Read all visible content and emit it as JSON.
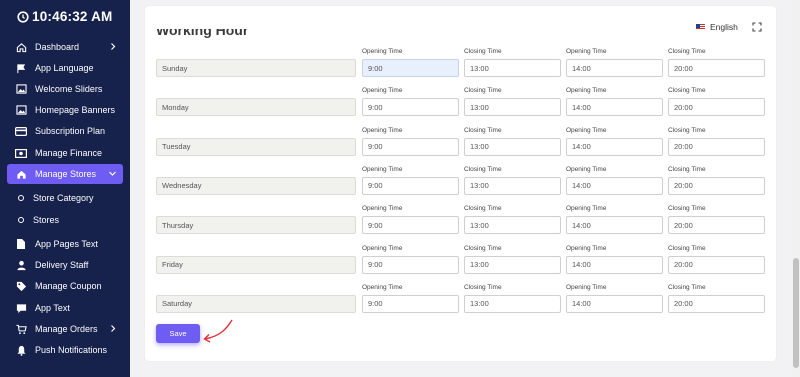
{
  "clock": "10:46:32 AM",
  "sidebar": {
    "items": [
      {
        "label": "Dashboard",
        "icon": "home-icon",
        "chevron": "right"
      },
      {
        "label": "App Language",
        "icon": "flag-icon"
      },
      {
        "label": "Welcome Sliders",
        "icon": "image-icon"
      },
      {
        "label": "Homepage Banners",
        "icon": "image-icon"
      },
      {
        "label": "Subscription Plan",
        "icon": "card-icon"
      },
      {
        "label": "Manage Finance",
        "icon": "money-icon"
      },
      {
        "label": "Manage Stores",
        "icon": "store-icon",
        "chevron": "down",
        "active": true
      },
      {
        "label": "Store Category",
        "icon": "circle-icon",
        "sub": true
      },
      {
        "label": "Stores",
        "icon": "circle-icon",
        "sub": true
      },
      {
        "label": "App Pages Text",
        "icon": "file-icon"
      },
      {
        "label": "Delivery Staff",
        "icon": "user-icon"
      },
      {
        "label": "Manage Coupon",
        "icon": "tag-icon"
      },
      {
        "label": "App Text",
        "icon": "chat-icon"
      },
      {
        "label": "Manage Orders",
        "icon": "cart-icon",
        "chevron": "right"
      },
      {
        "label": "Push Notifications",
        "icon": "bell-icon"
      }
    ]
  },
  "header": {
    "language": "English"
  },
  "section_title": "Working Hour",
  "labels": {
    "opening_time": "Opening Time",
    "closing_time": "Closing Time"
  },
  "days": [
    {
      "day": "Sunday",
      "open1": "9:00",
      "close1": "13:00",
      "open2": "14:00",
      "close2": "20:00"
    },
    {
      "day": "Monday",
      "open1": "9:00",
      "close1": "13:00",
      "open2": "14:00",
      "close2": "20:00"
    },
    {
      "day": "Tuesday",
      "open1": "9:00",
      "close1": "13:00",
      "open2": "14:00",
      "close2": "20:00"
    },
    {
      "day": "Wednesday",
      "open1": "9:00",
      "close1": "13:00",
      "open2": "14:00",
      "close2": "20:00"
    },
    {
      "day": "Thursday",
      "open1": "9:00",
      "close1": "13:00",
      "open2": "14:00",
      "close2": "20:00"
    },
    {
      "day": "Friday",
      "open1": "9:00",
      "close1": "13:00",
      "open2": "14:00",
      "close2": "20:00"
    },
    {
      "day": "Saturday",
      "open1": "9:00",
      "close1": "13:00",
      "open2": "14:00",
      "close2": "20:00"
    }
  ],
  "save_label": "Save",
  "colors": {
    "sidebar_bg": "#16214c",
    "accent": "#6f5cf2",
    "arrow": "#e0303a"
  }
}
